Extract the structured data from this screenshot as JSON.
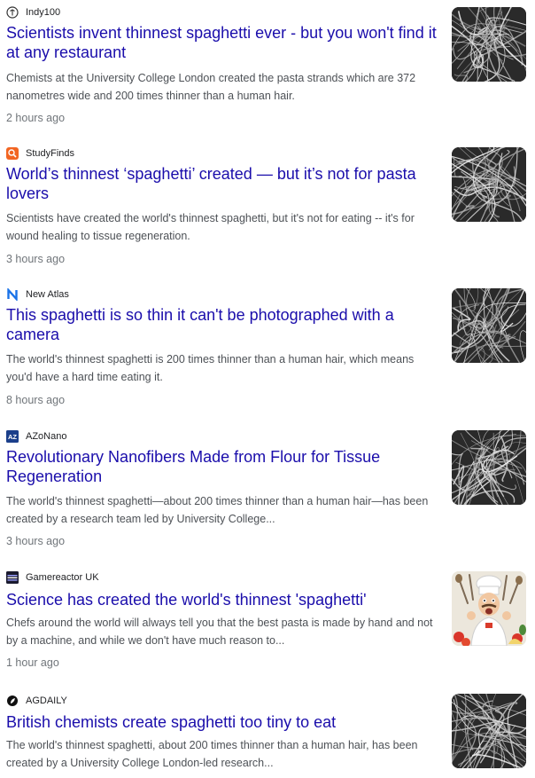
{
  "articles": [
    {
      "source": "Indy100",
      "source_icon": "indy100-logo-icon",
      "title": "Scientists invent thinnest spaghetti ever - but you won't find it at any restaurant",
      "snippet": "Chemists at the University College London created the pasta strands which are 372 nanometres wide and 200 times thinner than a human hair.",
      "time": "2 hours ago",
      "thumbnail": "nanofiber-image"
    },
    {
      "source": "StudyFinds",
      "source_icon": "studyfinds-logo-icon",
      "title": "World’s thinnest ‘spaghetti’ created — but it’s not for pasta lovers",
      "snippet": "Scientists have created the world's thinnest spaghetti, but it's not for eating -- it's for wound healing to tissue regeneration.",
      "time": "3 hours ago",
      "thumbnail": "nanofiber-image"
    },
    {
      "source": "New Atlas",
      "source_icon": "new-atlas-logo-icon",
      "title": "This spaghetti is so thin it can't be photographed with a camera",
      "snippet": "The world's thinnest spaghetti is 200 times thinner than a human hair, which means you'd have a hard time eating it.",
      "time": "8 hours ago",
      "thumbnail": "nanofiber-image"
    },
    {
      "source": "AZoNano",
      "source_icon": "azonano-logo-icon",
      "title": "Revolutionary Nanofibers Made from Flour for Tissue Regeneration",
      "snippet": "The world's thinnest spaghetti—about 200 times thinner than a human hair—has been created by a research team led by University College...",
      "time": "3 hours ago",
      "thumbnail": "nanofiber-image"
    },
    {
      "source": "Gamereactor UK",
      "source_icon": "gamereactor-logo-icon",
      "title": "Science has created the world's thinnest 'spaghetti'",
      "snippet": "Chefs around the world will always tell you that the best pasta is made by hand and not by a machine, and while we don't have much reason to...",
      "time": "1 hour ago",
      "thumbnail": "chef-illustration-image"
    },
    {
      "source": "AGDAILY",
      "source_icon": "agdaily-logo-icon",
      "title": "British chemists create spaghetti too tiny to eat",
      "snippet": "The world's thinnest spaghetti, about 200 times thinner than a human hair, has been created by a University College London-led research...",
      "time": "",
      "thumbnail": "nanofiber-image"
    }
  ],
  "colors": {
    "headline": "#1a0dab",
    "snippet": "#4d5156",
    "time": "#70757a",
    "studyfinds_brand": "#f26522",
    "new_atlas_brand": "#1a73e8",
    "azonano_brand": "#1b3f8b"
  }
}
